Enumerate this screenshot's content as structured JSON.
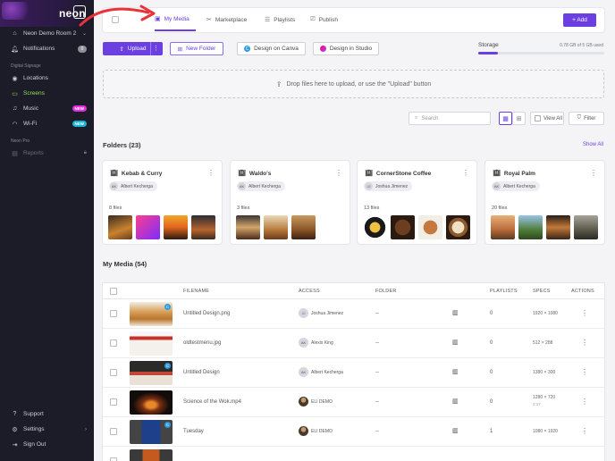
{
  "sidebar": {
    "logo": "neon",
    "location": "Neon Demo Room 2",
    "notifications_label": "Notifications",
    "notifications_count": "0",
    "section_signage": "Digital Signage",
    "items": [
      {
        "label": "Locations",
        "icon": "pin-icon"
      },
      {
        "label": "Screens",
        "icon": "monitor-icon"
      },
      {
        "label": "Music",
        "icon": "music-icon",
        "badge": "NEW"
      },
      {
        "label": "Wi-Fi",
        "icon": "wifi-icon",
        "badge": "NEW"
      }
    ],
    "section_pro": "Neon Pro",
    "reports_label": "Reports",
    "bottom": [
      {
        "label": "Support",
        "icon": "help-icon"
      },
      {
        "label": "Settings",
        "icon": "gear-icon"
      },
      {
        "label": "Sign Out",
        "icon": "logout-icon"
      }
    ]
  },
  "tabs": [
    {
      "label": "My Media",
      "icon": "image-icon",
      "active": true
    },
    {
      "label": "Marketplace",
      "icon": "tools-icon"
    },
    {
      "label": "Playlists",
      "icon": "list-icon"
    },
    {
      "label": "Publish",
      "icon": "cast-icon"
    }
  ],
  "add_label": "+ Add",
  "toolbar": {
    "upload_label": "Upload",
    "new_folder_label": "New Folder",
    "canva_label": "Design on Canva",
    "studio_label": "Design in Studio"
  },
  "storage": {
    "label": "Storage",
    "value": "0.78 GB of 5 GB used",
    "fraction": 0.156
  },
  "dropzone_text": "Drop files here to upload, or use the \"Upload\" button",
  "search_placeholder": "Search",
  "view_all_label": "View All",
  "filter_label": "Filter",
  "folders_title": "Folders (23)",
  "show_all_label": "Show All",
  "folders": [
    {
      "name": "Kebab & Curry",
      "owner_initials": "AK",
      "owner": "Albert Kecherga",
      "files": "8 files"
    },
    {
      "name": "Waldo's",
      "owner_initials": "AK",
      "owner": "Albert Kecherga",
      "files": "3 files"
    },
    {
      "name": "CornerStone Coffee",
      "owner_initials": "JJ",
      "owner": "Joshua Jimenez",
      "files": "13 files"
    },
    {
      "name": "Royal Palm",
      "owner_initials": "AK",
      "owner": "Albert Kecherga",
      "files": "20 files"
    }
  ],
  "media_title": "My Media (54)",
  "table": {
    "headers": {
      "filename": "FILENAME",
      "access": "ACCESS",
      "folder": "FOLDER",
      "playlists": "PLAYLISTS",
      "specs": "SPECS",
      "actions": "ACTIONS"
    },
    "rows": [
      {
        "filename": "Untitled Design.png",
        "access_initials": "JJ",
        "access": "Joshua Jimenez",
        "folder": "--",
        "playlists": "0",
        "specs": "1920 × 1080",
        "specs_sub": ""
      },
      {
        "filename": "oldtestmenu.jpg",
        "access_initials": "AK",
        "access": "Alexis King",
        "folder": "--",
        "playlists": "0",
        "specs": "512 × 288",
        "specs_sub": ""
      },
      {
        "filename": "Untitled Design",
        "access_initials": "AK",
        "access": "Albert Kecherga",
        "folder": "--",
        "playlists": "0",
        "specs": "1380 × 300",
        "specs_sub": ""
      },
      {
        "filename": "Science of the Wok.mp4",
        "access_initials": "",
        "access": "ELI DEMO",
        "folder": "--",
        "playlists": "0",
        "specs": "1280 × 720",
        "specs_sub": "2:17"
      },
      {
        "filename": "Tuesday",
        "access_initials": "",
        "access": "ELI DEMO",
        "folder": "--",
        "playlists": "1",
        "specs": "1080 × 1920",
        "specs_sub": ""
      }
    ]
  },
  "colors": {
    "accent": "#6b3fe0",
    "sidebar_bg": "#1c1b28",
    "active_nav": "#8ee25b",
    "annotation_arrow": "#e8333a"
  }
}
